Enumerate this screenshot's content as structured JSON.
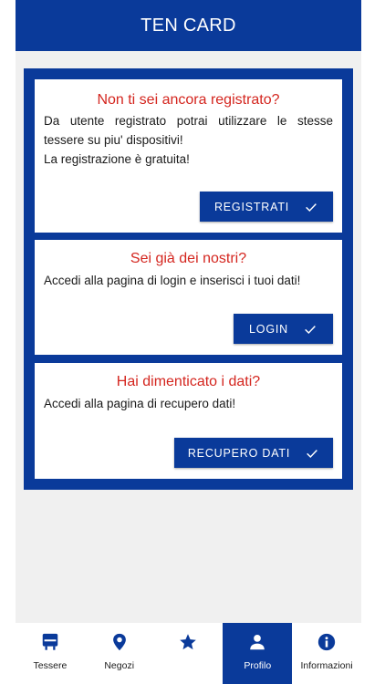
{
  "app_bar": {
    "title": "TEN CARD"
  },
  "cards": [
    {
      "title": "Non ti sei ancora registrato?",
      "lines": [
        "Da utente registrato potrai utilizzare le stesse tessere su piu' dispositivi!",
        "La registrazione è gratuita!"
      ],
      "button": "REGISTRATI"
    },
    {
      "title": "Sei già dei nostri?",
      "lines": [
        "Accedi alla pagina di login e inserisci i tuoi dati!"
      ],
      "button": "LOGIN"
    },
    {
      "title": "Hai dimenticato i dati?",
      "lines": [
        "Accedi alla pagina di recupero dati!"
      ],
      "button": "RECUPERO DATI"
    }
  ],
  "nav": {
    "active": "Profilo",
    "items": [
      {
        "label": "Tessere",
        "icon": "card-icon"
      },
      {
        "label": "Negozi",
        "icon": "location-pin-icon"
      },
      {
        "label": "",
        "icon": "star-icon"
      },
      {
        "label": "Profilo",
        "icon": "person-icon"
      },
      {
        "label": "Informazioni",
        "icon": "info-icon"
      }
    ]
  },
  "colors": {
    "primary": "#0a3a9a",
    "title_red": "#d4261f",
    "background": "#f0f0f0"
  }
}
